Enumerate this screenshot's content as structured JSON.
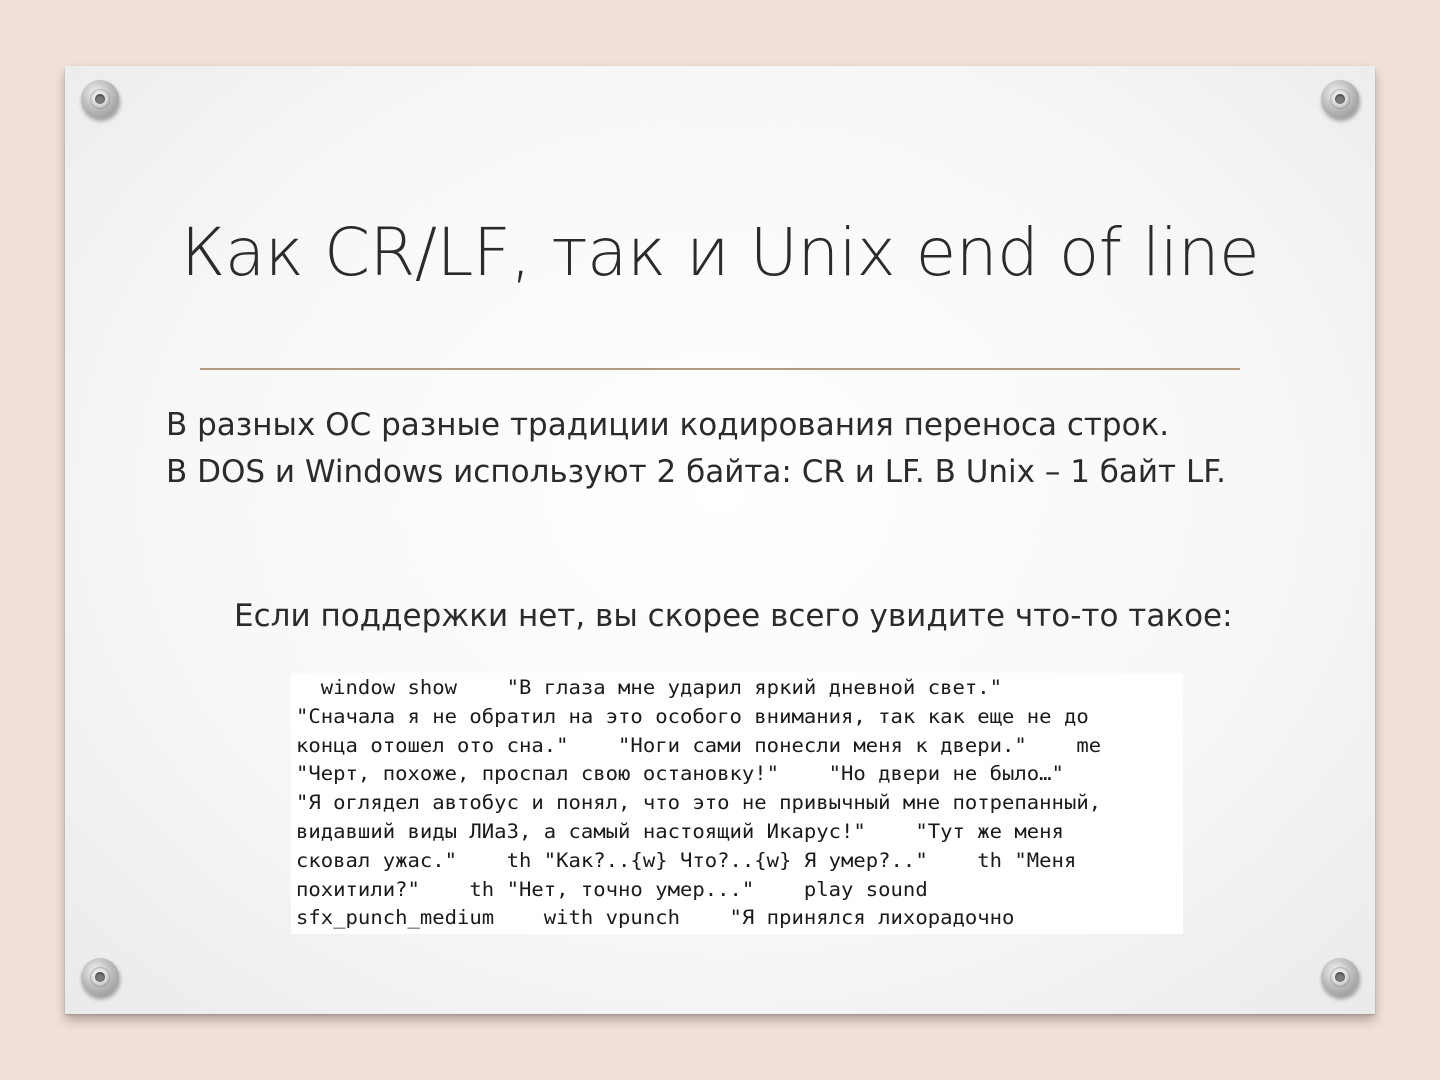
{
  "slide": {
    "title": "Как CR/LF, так и Unix end of line",
    "body_lines": [
      "В разных ОС разные традиции кодирования переноса строк.",
      "В DOS и Windows используют 2 байта: CR и LF. В Unix – 1 байт LF."
    ],
    "subline": "Если поддержки нет, вы скорее всего увидите что-то такое:",
    "code_lines": [
      "  window show    \"В глаза мне ударил яркий дневной свет.\"",
      "\"Сначала я не обратил на это особого внимания, так как еще не до",
      "конца отошел ото сна.\"    \"Ноги сами понесли меня к двери.\"    me",
      "\"Черт, похоже, проспал свою остановку!\"    \"Но двери не было…\"",
      "\"Я оглядел автобус и понял, что это не привычный мне потрепанный,",
      "видавший виды ЛИаЗ, а самый настоящий Икарус!\"    \"Тут же меня",
      "сковал ужас.\"    th \"Как?..{w} Что?..{w} Я умер?..\"    th \"Меня",
      "похитили?\"    th \"Нет, точно умер...\"    play sound",
      "sfx_punch_medium    with vpunch    \"Я принялся лихорадочно"
    ]
  },
  "colors": {
    "background": "#f2e0d8",
    "slide": "#ffffff",
    "divider": "#b39c7e",
    "text": "#2b2b2b"
  },
  "icons": [
    "screw-icon"
  ]
}
